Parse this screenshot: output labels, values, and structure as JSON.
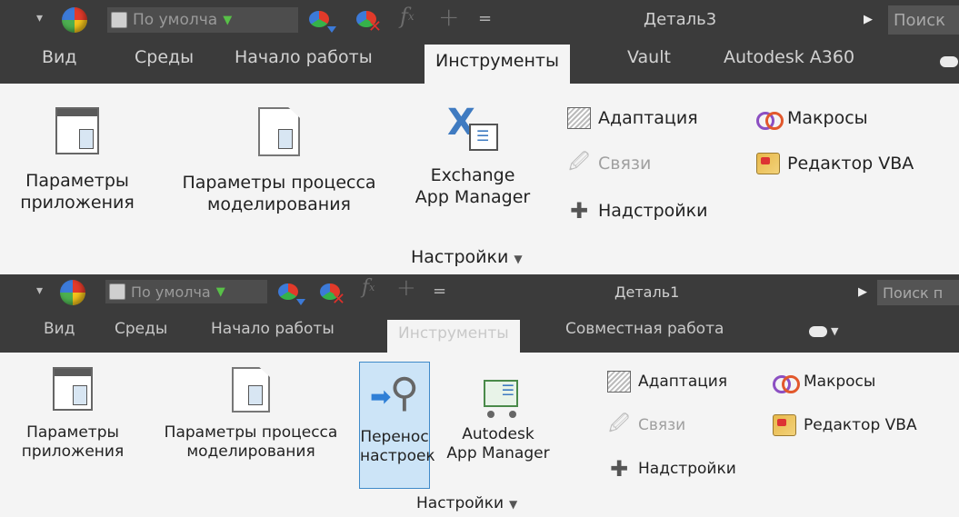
{
  "top": {
    "quick_access": {
      "style_value": "По умолча",
      "fx_label": "f",
      "fx_sub": "x"
    },
    "document_title": "Деталь3",
    "search_placeholder": "Поиск",
    "tabs": [
      "Вид",
      "Среды",
      "Начало работы",
      "Инструменты",
      "Vault",
      "Autodesk A360"
    ],
    "active_tab_index": 3,
    "ribbon": {
      "app_options": [
        "Параметры",
        "приложения"
      ],
      "doc_settings": [
        "Параметры процесса",
        "моделирования"
      ],
      "exchange": [
        "Exchange",
        "App Manager"
      ],
      "adaptation": "Адаптация",
      "links": "Связи",
      "addins": "Надстройки",
      "macros": "Макросы",
      "vba": "Редактор VBA",
      "group": "Настройки"
    }
  },
  "bottom": {
    "quick_access": {
      "style_value": "По умолча",
      "fx_label": "f",
      "fx_sub": "x"
    },
    "document_title": "Деталь1",
    "search_placeholder": "Поиск п",
    "tabs": [
      "Вид",
      "Среды",
      "Начало работы",
      "Инструменты",
      "Совместная работа"
    ],
    "active_tab_index": 3,
    "ribbon": {
      "app_options": [
        "Параметры",
        "приложения"
      ],
      "doc_settings": [
        "Параметры процесса",
        "моделирования"
      ],
      "migrate": [
        "Перенос",
        "настроек"
      ],
      "autodesk_app": [
        "Autodesk",
        "App Manager"
      ],
      "adaptation": "Адаптация",
      "links": "Связи",
      "addins": "Надстройки",
      "macros": "Макросы",
      "vba": "Редактор VBA",
      "group": "Настройки"
    }
  },
  "colors": {
    "titlebar_bg": "#3b3b3b",
    "ribbon_bg": "#f4f4f4",
    "selected_bg": "#cce4f7",
    "selected_border": "#3f8ac9"
  }
}
